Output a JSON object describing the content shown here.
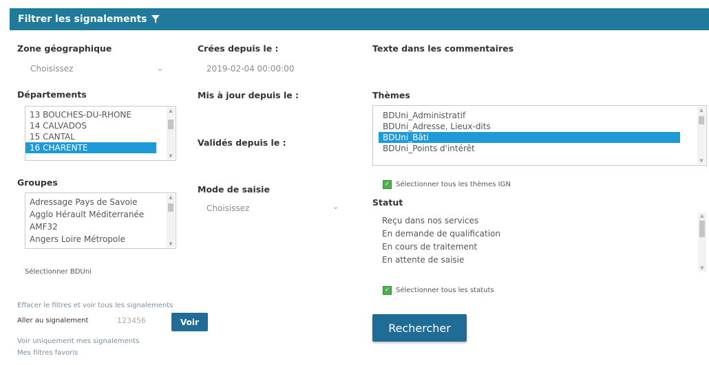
{
  "header": {
    "title": "Filtrer les signalements"
  },
  "zone": {
    "label": "Zone géographique",
    "placeholder": "Choisissez"
  },
  "created": {
    "label": "Crées depuis le :",
    "value": "2019-02-04 00:00:00"
  },
  "comments": {
    "label": "Texte dans les commentaires"
  },
  "departements": {
    "label": "Départements",
    "items": [
      "13 BOUCHES-DU-RHONE",
      "14 CALVADOS",
      "15 CANTAL",
      "16 CHARENTE"
    ],
    "selected_index": 3
  },
  "updated": {
    "label": "Mis à jour depuis le :"
  },
  "themes": {
    "label": "Thèmes",
    "items": [
      "BDUni_Administratif",
      "BDUni_Adresse, Lieux-dits",
      "BDUni_Bâti",
      "BDUni_Points d'intérêt"
    ],
    "selected_index": 2,
    "select_all": "Sélectionner tous les thèmes IGN"
  },
  "validated": {
    "label": "Validés depuis le :"
  },
  "groupes": {
    "label": "Groupes",
    "items": [
      "Adressage Pays de Savoie",
      "Agglo Hérault Méditerranée",
      "AMF32",
      "Angers Loire Métropole"
    ]
  },
  "mode": {
    "label": "Mode de saisie",
    "placeholder": "Choisissez"
  },
  "statut": {
    "label": "Statut",
    "items": [
      "Reçu dans nos services",
      "En demande de qualification",
      "En cours de traitement",
      "En attente de saisie"
    ],
    "select_all": "Sélectionner tous les statuts"
  },
  "select_bduni": "Sélectionner BDUni",
  "clear_filters": "Effacer le filtres et voir tous les signalements",
  "goto": {
    "label": "Aller au signalement",
    "placeholder": "123456",
    "button": "Voir"
  },
  "search_button": "Rechercher",
  "only_mine": "Voir uniquement mes signalements",
  "my_filters": "Mes filtres favoris",
  "colors": {
    "header": "#1f7a9c",
    "selection": "#1e9bd6",
    "button": "#1f6d96",
    "checkbox": "#4caf50"
  }
}
